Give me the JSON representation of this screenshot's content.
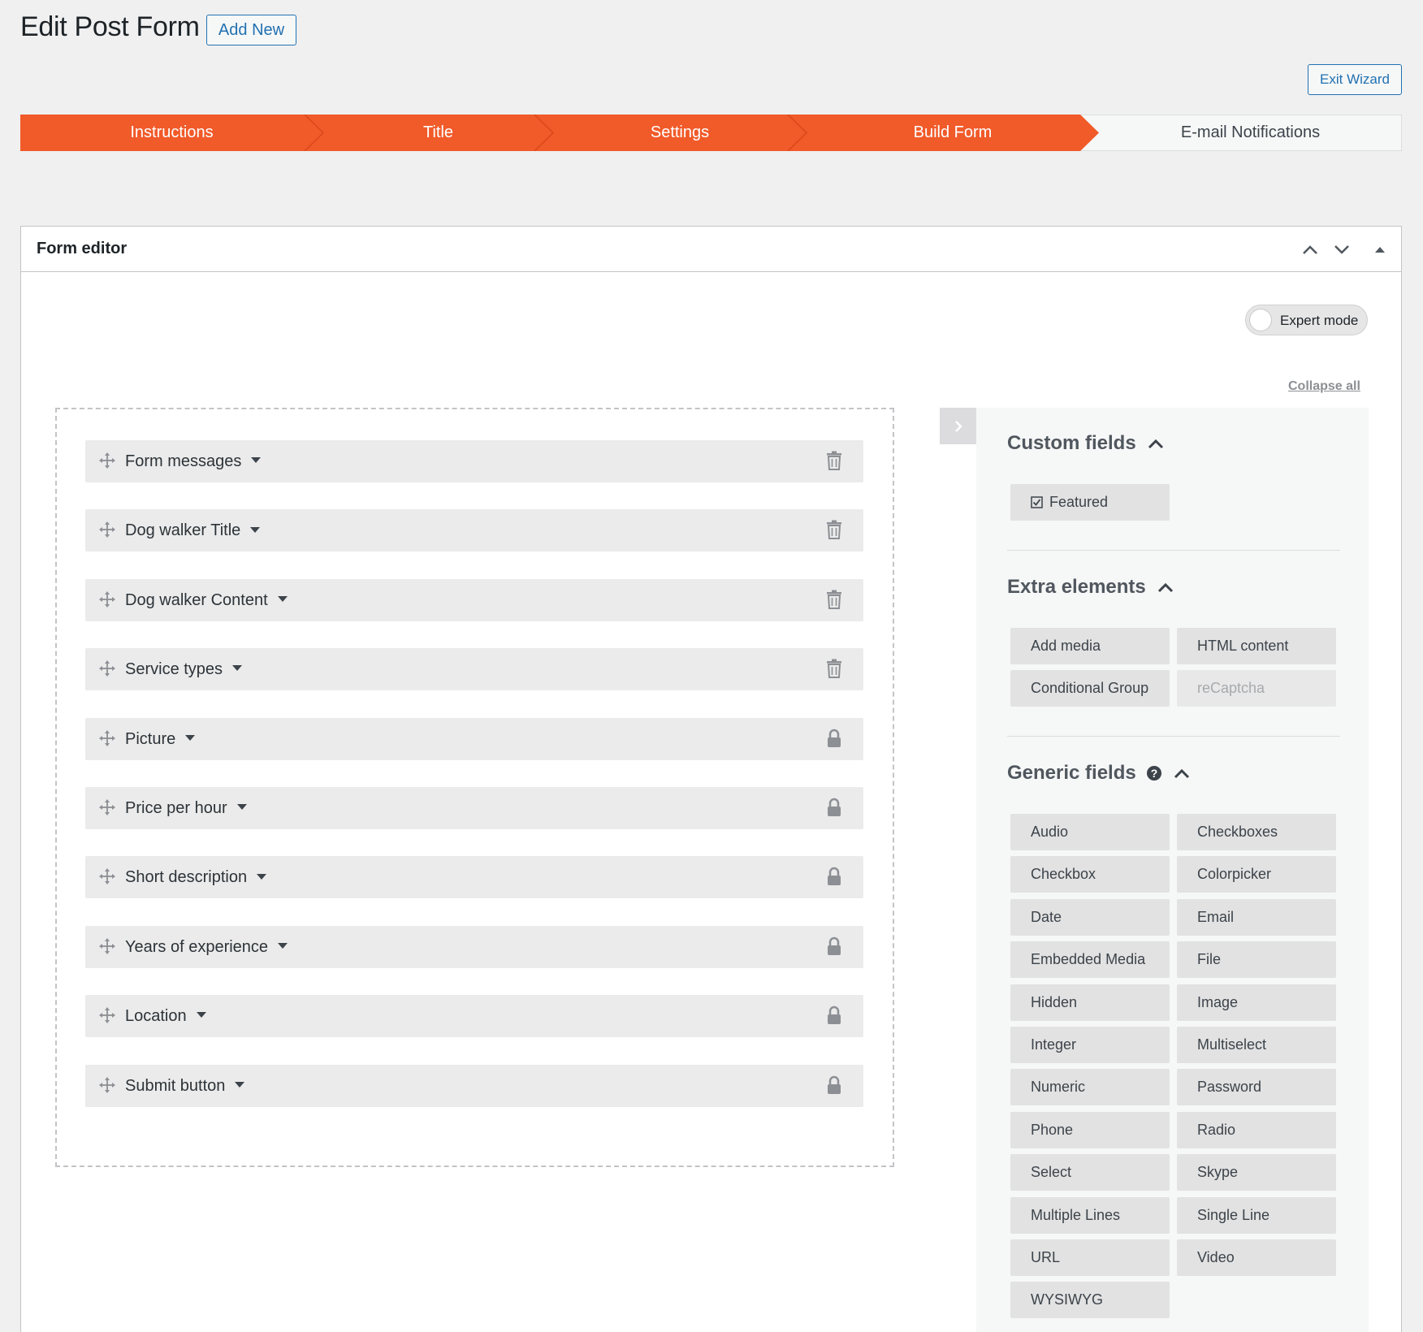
{
  "header": {
    "title": "Edit Post Form",
    "add_new": "Add New",
    "exit_wizard": "Exit Wizard"
  },
  "wizard": {
    "steps": [
      {
        "label": "Instructions",
        "active": true
      },
      {
        "label": "Title",
        "active": true
      },
      {
        "label": "Settings",
        "active": true
      },
      {
        "label": "Build Form",
        "active": true
      },
      {
        "label": "E-mail Notifications",
        "active": false
      }
    ],
    "active_color": "#f15a29"
  },
  "editor": {
    "title": "Form editor",
    "expert_mode": "Expert mode",
    "collapse_all": "Collapse all",
    "fields": [
      {
        "label": "Form messages",
        "icon": "trash-icon"
      },
      {
        "label": "Dog walker Title",
        "icon": "trash-icon"
      },
      {
        "label": "Dog walker Content",
        "icon": "trash-icon"
      },
      {
        "label": "Service types",
        "icon": "trash-icon"
      },
      {
        "label": "Picture",
        "icon": "lock-icon"
      },
      {
        "label": "Price per hour",
        "icon": "lock-icon"
      },
      {
        "label": "Short description",
        "icon": "lock-icon"
      },
      {
        "label": "Years of experience",
        "icon": "lock-icon"
      },
      {
        "label": "Location",
        "icon": "lock-icon"
      },
      {
        "label": "Submit button",
        "icon": "lock-icon"
      }
    ]
  },
  "sidebar": {
    "custom_fields": {
      "title": "Custom fields",
      "items": [
        "Featured"
      ]
    },
    "extra_elements": {
      "title": "Extra elements",
      "items": [
        "Add media",
        "HTML content",
        "Conditional Group",
        "reCaptcha"
      ]
    },
    "generic_fields": {
      "title": "Generic fields",
      "items": [
        "Audio",
        "Checkboxes",
        "Checkbox",
        "Colorpicker",
        "Date",
        "Email",
        "Embedded Media",
        "File",
        "Hidden",
        "Image",
        "Integer",
        "Multiselect",
        "Numeric",
        "Password",
        "Phone",
        "Radio",
        "Select",
        "Skype",
        "Multiple Lines",
        "Single Line",
        "URL",
        "Video",
        "WYSIWYG"
      ]
    }
  }
}
